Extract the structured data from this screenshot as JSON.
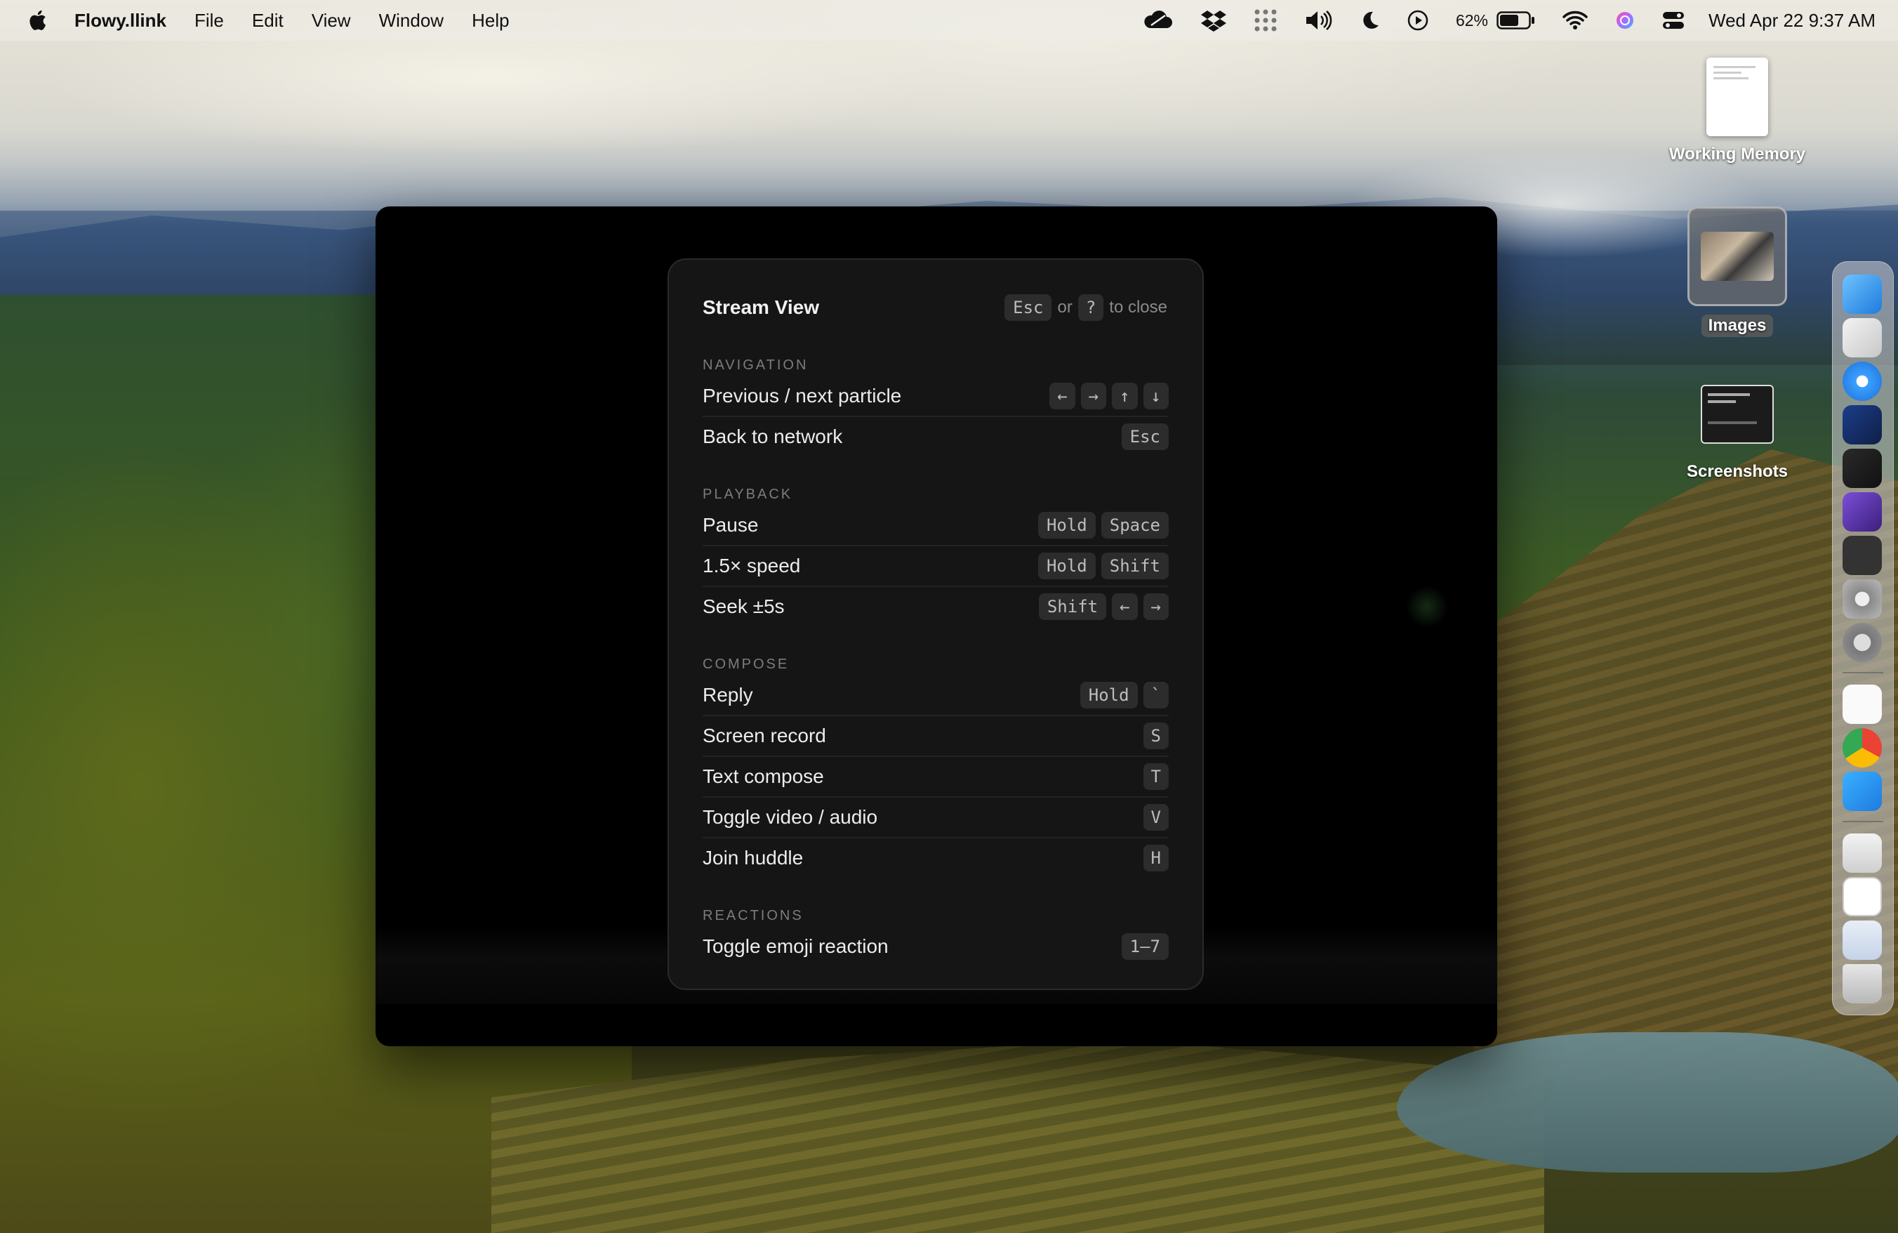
{
  "menubar": {
    "app_name": "Flowy.llink",
    "menus": [
      "File",
      "Edit",
      "View",
      "Window",
      "Help"
    ],
    "battery_percent": "62%",
    "clock": "Wed Apr 22  9:37 AM",
    "status_icons": [
      "cloud-icon",
      "dropbox-icon",
      "grid-icon",
      "volume-icon",
      "moon-icon",
      "play-circle-icon",
      "battery-icon",
      "wifi-icon",
      "siri-icon",
      "control-center-icon"
    ]
  },
  "panel": {
    "title": "Stream View",
    "close_hint": {
      "key1": "Esc",
      "or": "or",
      "key2": "?",
      "suffix": "to close"
    },
    "sections": [
      {
        "label": "NAVIGATION",
        "rows": [
          {
            "action": "Previous / next particle",
            "keys": [
              "←",
              "→",
              "↑",
              "↓"
            ]
          },
          {
            "action": "Back to network",
            "keys": [
              "Esc"
            ]
          }
        ]
      },
      {
        "label": "PLAYBACK",
        "rows": [
          {
            "action": "Pause",
            "keys": [
              "Hold",
              "Space"
            ]
          },
          {
            "action": "1.5× speed",
            "keys": [
              "Hold",
              "Shift"
            ]
          },
          {
            "action": "Seek ±5s",
            "keys": [
              "Shift",
              "←",
              "→"
            ]
          }
        ]
      },
      {
        "label": "COMPOSE",
        "rows": [
          {
            "action": "Reply",
            "keys": [
              "Hold",
              "`"
            ]
          },
          {
            "action": "Screen record",
            "keys": [
              "S"
            ]
          },
          {
            "action": "Text compose",
            "keys": [
              "T"
            ]
          },
          {
            "action": "Toggle video / audio",
            "keys": [
              "V"
            ]
          },
          {
            "action": "Join huddle",
            "keys": [
              "H"
            ]
          }
        ]
      },
      {
        "label": "REACTIONS",
        "rows": [
          {
            "action": "Toggle emoji reaction",
            "keys": [
              "1–7"
            ]
          }
        ]
      }
    ]
  },
  "desktop": {
    "working_memory_label": "Working Memory",
    "images_label": "Images",
    "screenshots_label": "Screenshots"
  },
  "dock": {
    "items": [
      "finder-icon",
      "launchpad-icon",
      "safari-icon",
      "app-icon",
      "activity-monitor-icon",
      "obsidian-icon",
      "fl-app-icon",
      "disk-utility-icon",
      "system-settings-icon",
      "textedit-icon",
      "chrome-icon",
      "icloud-icon",
      "preview-icon",
      "document-icon",
      "spreadsheet-icon",
      "trash-icon"
    ]
  }
}
